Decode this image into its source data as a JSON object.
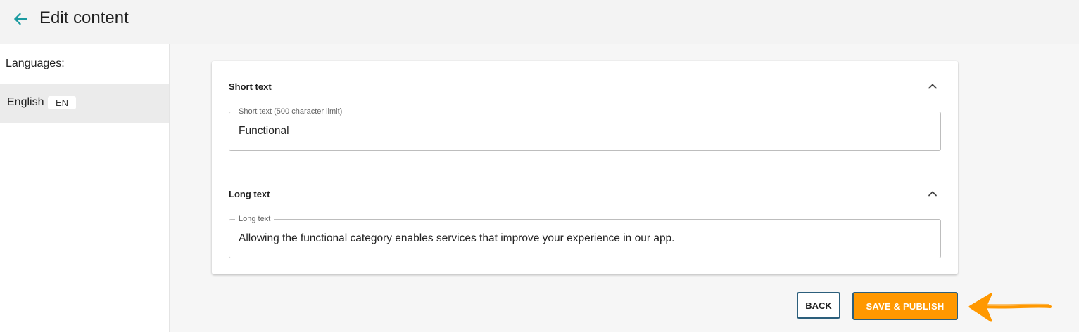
{
  "header": {
    "title": "Edit content"
  },
  "sidebar": {
    "heading": "Languages:",
    "languages": [
      {
        "name": "English",
        "code": "EN"
      }
    ]
  },
  "sections": [
    {
      "title": "Short text",
      "field_label": "Short text (500 character limit)",
      "value": "Functional"
    },
    {
      "title": "Long text",
      "field_label": "Long text",
      "value": "Allowing the functional category enables services that improve your experience in our app."
    }
  ],
  "actions": {
    "back_label": "BACK",
    "save_label": "SAVE & PUBLISH"
  },
  "colors": {
    "accent_teal": "#1a9aa0",
    "primary_orange": "#ff9800",
    "button_border": "#2c5f7c",
    "annotation_orange": "#ff9800"
  },
  "icons": {
    "back": "arrow-left-icon",
    "collapse": "chevron-up-icon",
    "annotation": "annotation-arrow-icon"
  }
}
